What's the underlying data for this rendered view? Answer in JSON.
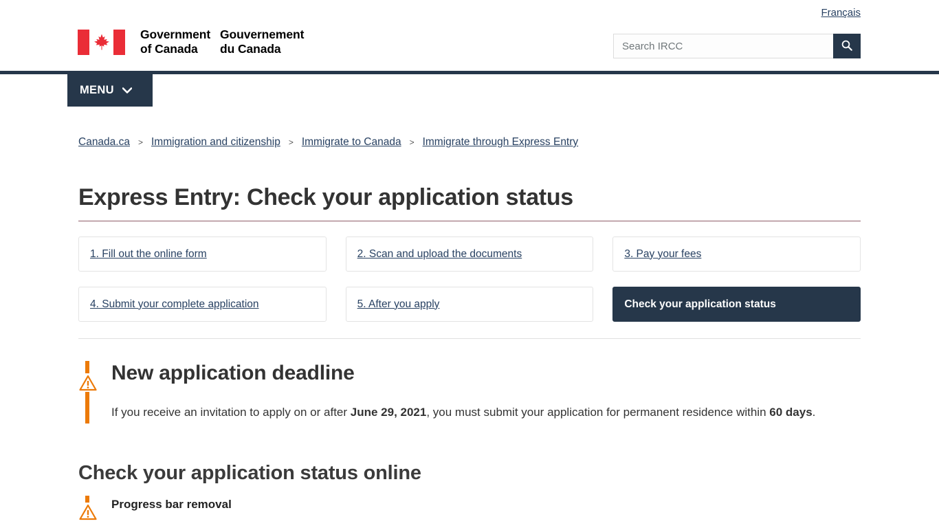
{
  "header": {
    "lang_toggle": "Français",
    "wordmark_en_line1": "Government",
    "wordmark_en_line2": "of Canada",
    "wordmark_fr_line1": "Gouvernement",
    "wordmark_fr_line2": "du Canada",
    "flag_icon": "canada-flag-icon",
    "search_placeholder": "Search IRCC",
    "search_value": "",
    "search_icon": "search-icon",
    "menu_label": "MENU",
    "menu_chevron_icon": "chevron-down-icon"
  },
  "breadcrumb": {
    "separator": ">",
    "items": [
      {
        "label": "Canada.ca"
      },
      {
        "label": "Immigration and citizenship"
      },
      {
        "label": "Immigrate to Canada"
      },
      {
        "label": "Immigrate through Express Entry"
      }
    ]
  },
  "main": {
    "page_title": "Express Entry: Check your application status",
    "steps": [
      {
        "label": "1. Fill out the online form",
        "active": false
      },
      {
        "label": "2. Scan and upload the documents",
        "active": false
      },
      {
        "label": "3. Pay your fees",
        "active": false
      },
      {
        "label": "4. Submit your complete application",
        "active": false
      },
      {
        "label": "5. After you apply",
        "active": false
      },
      {
        "label": "Check your application status",
        "active": true
      }
    ],
    "alert": {
      "icon": "warning-triangle-icon",
      "title": "New application deadline",
      "body_part1": "If you receive an invitation to apply on or after ",
      "body_bold1": "June 29, 2021",
      "body_part2": ", you must submit your application for permanent residence within ",
      "body_bold2": "60 days",
      "body_part3": "."
    },
    "section_heading": "Check your application status online",
    "alert2": {
      "icon": "warning-triangle-icon",
      "title": "Progress bar removal"
    }
  },
  "colors": {
    "brand_navy": "#26374A",
    "link_blue": "#284162",
    "flag_red": "#EA2D37",
    "alert_orange": "#ec7a08",
    "title_rule": "#8f5b68"
  }
}
